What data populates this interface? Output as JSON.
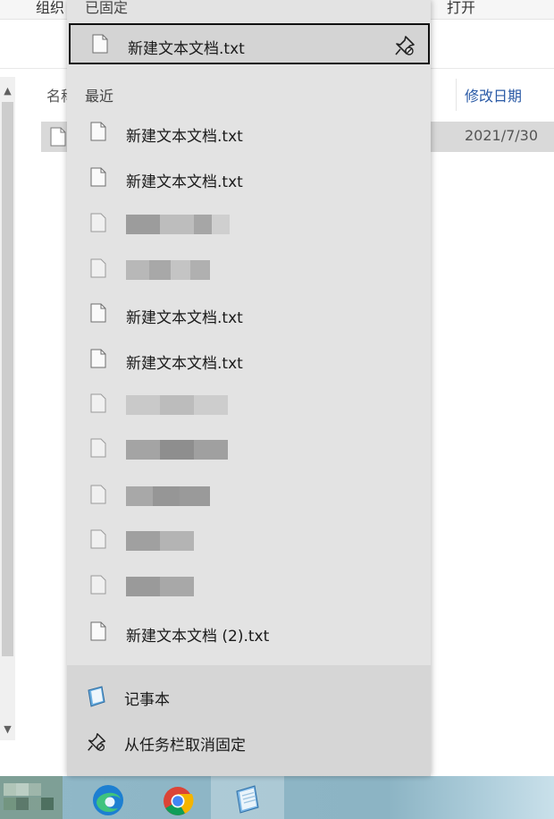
{
  "explorer": {
    "ribbon_left": "组织",
    "ribbon_right": "打开",
    "column_name": "名称",
    "column_date": "修改日期",
    "file_date": "2021/7/30"
  },
  "jumplist": {
    "pinned_header": "已固定",
    "pinned_items": [
      {
        "label": "新建文本文档.txt"
      }
    ],
    "recent_header": "最近",
    "recent_items": [
      {
        "label": "新建文本文档.txt"
      },
      {
        "label": "新建文本文档.txt"
      },
      {
        "label": ""
      },
      {
        "label": ""
      },
      {
        "label": "新建文本文档.txt"
      },
      {
        "label": "新建文本文档.txt"
      },
      {
        "label": ""
      },
      {
        "label": ""
      },
      {
        "label": ""
      },
      {
        "label": ""
      },
      {
        "label": ""
      },
      {
        "label": "新建文本文档 (2).txt"
      }
    ],
    "tasks": [
      {
        "label": "记事本",
        "icon": "notepad-icon"
      },
      {
        "label": "从任务栏取消固定",
        "icon": "unpin-icon"
      }
    ]
  },
  "taskbar": {
    "apps": [
      {
        "icon": "edge-icon"
      },
      {
        "icon": "chrome-icon"
      },
      {
        "icon": "notepad-icon"
      }
    ]
  },
  "colors": {
    "jumplist_bg": "#e3e3e3",
    "tasks_bg": "#d6d6d6",
    "focus_border": "#111111",
    "date_header": "#2a5aa6"
  }
}
